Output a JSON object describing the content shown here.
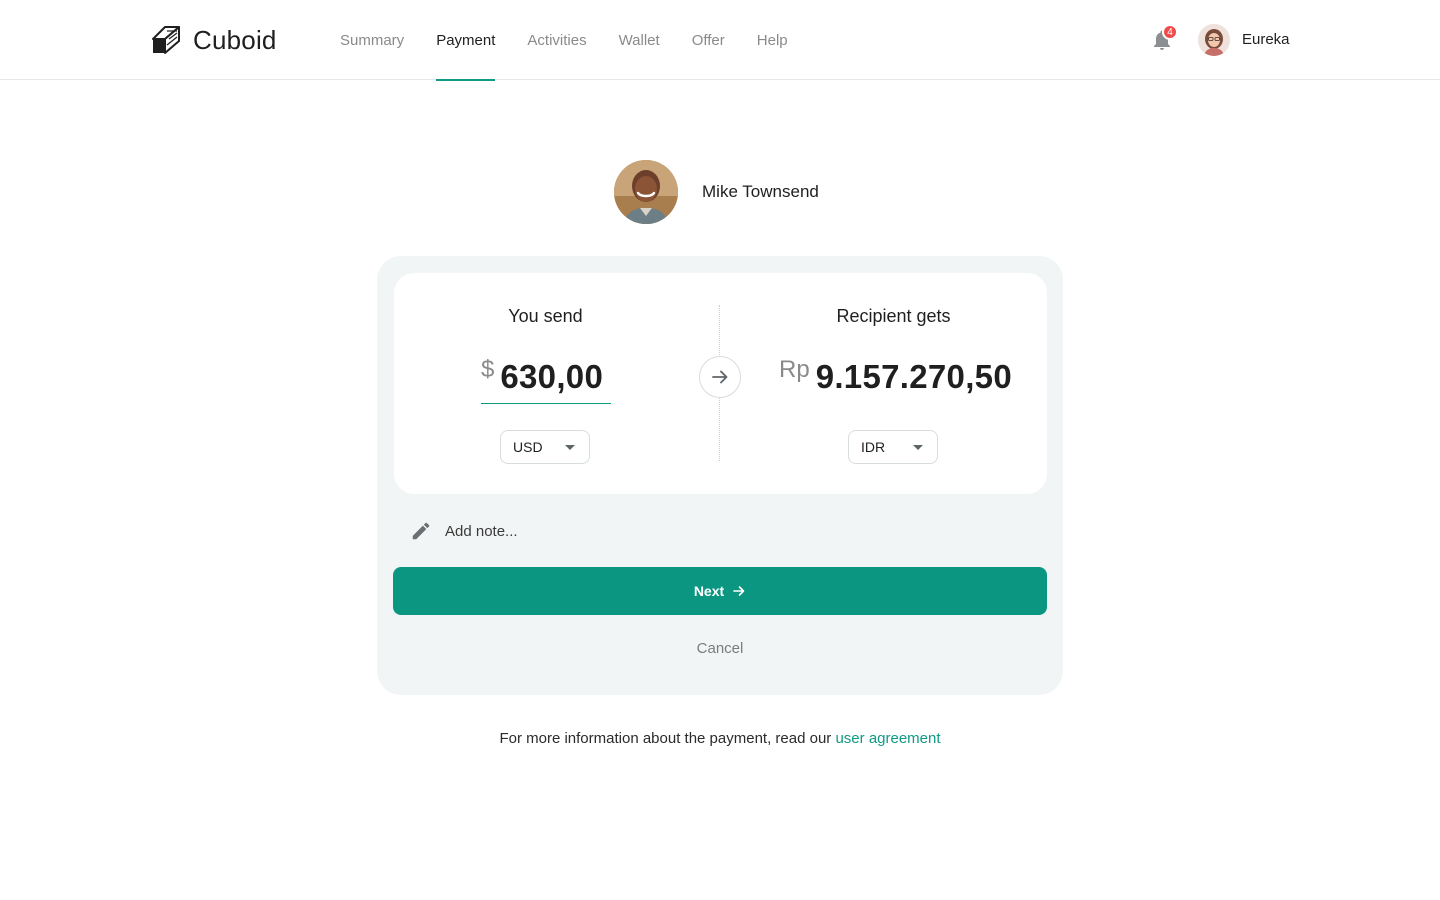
{
  "brand": {
    "name": "Cuboid",
    "accent": "#0f9a84",
    "logo_icon": "cube-logo-icon"
  },
  "nav": {
    "items": [
      {
        "label": "Summary",
        "active": false
      },
      {
        "label": "Payment",
        "active": true
      },
      {
        "label": "Activities",
        "active": false
      },
      {
        "label": "Wallet",
        "active": false
      },
      {
        "label": "Offer",
        "active": false
      },
      {
        "label": "Help",
        "active": false
      }
    ]
  },
  "header": {
    "notifications_count": "4",
    "notification_icon": "bell-icon",
    "user_name": "Eureka"
  },
  "recipient": {
    "name": "Mike Townsend"
  },
  "transfer": {
    "send": {
      "title": "You send",
      "symbol": "$",
      "amount": "630,00",
      "currency": "USD"
    },
    "receive": {
      "title": "Recipient gets",
      "symbol": "Rp",
      "amount": "9.157.270,50",
      "currency": "IDR"
    },
    "swap_icon": "arrow-right-icon"
  },
  "note": {
    "placeholder": "Add note...",
    "icon": "pencil-icon"
  },
  "actions": {
    "next_label": "Next",
    "cancel_label": "Cancel"
  },
  "footer": {
    "text": "For more information about the payment, read our ",
    "link_label": "user agreement"
  }
}
